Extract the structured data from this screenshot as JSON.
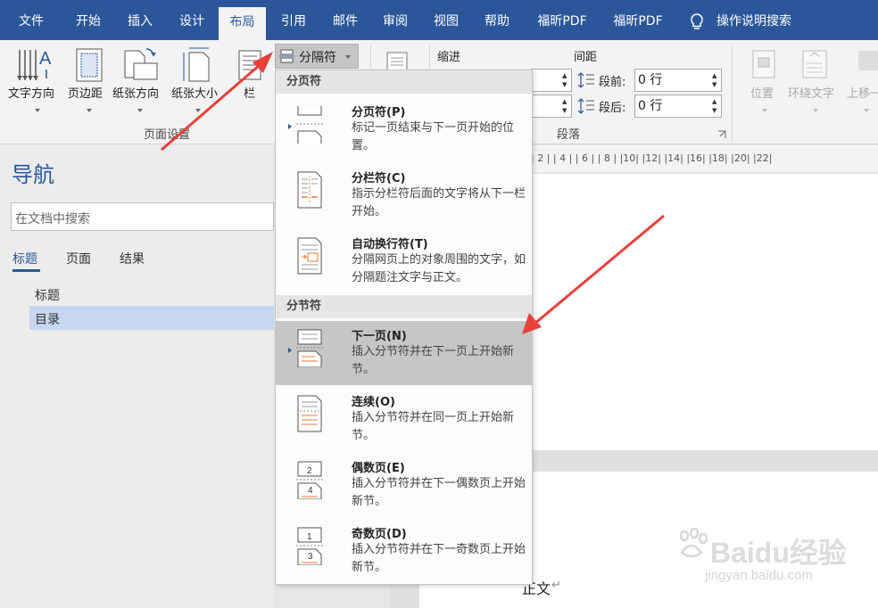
{
  "tabs": [
    "文件",
    "开始",
    "插入",
    "设计",
    "布局",
    "引用",
    "邮件",
    "审阅",
    "视图",
    "帮助",
    "福昕PDF",
    "福昕PDF",
    "操作说明搜索"
  ],
  "ribbon": {
    "page_setup": {
      "buttons": [
        "文字方向",
        "页边距",
        "纸张方向",
        "纸张大小",
        "栏"
      ],
      "group_label": "页面设置"
    },
    "breaks_button": "分隔符",
    "indent_label": "缩进",
    "spacing_label": "间距",
    "before_label": "段前:",
    "before_value": "0 行",
    "after_label": "段后:",
    "after_value": "0 行",
    "paragraph_label": "段落",
    "arrange": [
      "位置",
      "环绕文字",
      "上移一"
    ]
  },
  "nav": {
    "title": "导航",
    "search_placeholder": "在文档中搜索",
    "tabs": [
      "标题",
      "页面",
      "结果"
    ],
    "items": [
      "标题",
      "目录"
    ]
  },
  "ruler": "| 2 |   | 4 |   | 6 |   | 8 |   |10|   |12|   |14|   |16|   |18|   |20|   |22|",
  "document": {
    "body_text": "正文",
    "paragraph_mark": "↵"
  },
  "dropdown": {
    "page_breaks_header": "分页符",
    "section_breaks_header": "分节符",
    "items": [
      {
        "title": "分页符(P)",
        "desc": "标记一页结束与下一页开始的位置。"
      },
      {
        "title": "分栏符(C)",
        "desc": "指示分栏符后面的文字将从下一栏开始。"
      },
      {
        "title": "自动换行符(T)",
        "desc": "分隔网页上的对象周围的文字，如分隔题注文字与正文。"
      },
      {
        "title": "下一页(N)",
        "desc": "插入分节符并在下一页上开始新节。"
      },
      {
        "title": "连续(O)",
        "desc": "插入分节符并在同一页上开始新节。"
      },
      {
        "title": "偶数页(E)",
        "desc": "插入分节符并在下一偶数页上开始新节。"
      },
      {
        "title": "奇数页(D)",
        "desc": "插入分节符并在下一奇数页上开始新节。"
      }
    ]
  },
  "watermark": {
    "brand": "Baidu经验",
    "url": "jingyan.baidu.com"
  },
  "colors": {
    "accent": "#2b579a",
    "arrow": "#e8403a",
    "icon_orange": "#e07b39"
  }
}
